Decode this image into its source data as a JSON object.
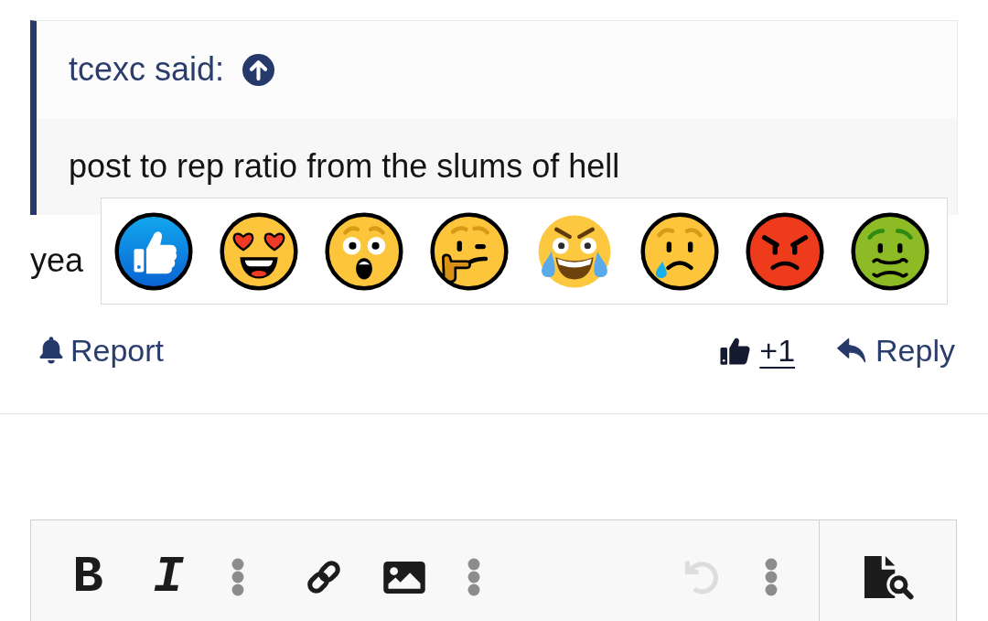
{
  "quote": {
    "author": "tcexc said:",
    "text": "post to rep ratio from the slums of hell"
  },
  "post": {
    "text": "yea"
  },
  "reaction_picker": {
    "reactions": [
      {
        "kind": "like"
      },
      {
        "kind": "love"
      },
      {
        "kind": "wow"
      },
      {
        "kind": "thinking"
      },
      {
        "kind": "haha"
      },
      {
        "kind": "sad"
      },
      {
        "kind": "angry"
      },
      {
        "kind": "sick"
      }
    ]
  },
  "actions": {
    "report": "Report",
    "reaction_count": "+1",
    "reply": "Reply"
  },
  "editor_toolbar": {
    "groups": [
      {
        "tools": [
          {
            "kind": "bold",
            "label": "B",
            "disabled": false
          },
          {
            "kind": "italic",
            "label": "I",
            "disabled": false
          },
          {
            "kind": "more",
            "disabled": false
          }
        ]
      },
      {
        "tools": [
          {
            "kind": "link",
            "disabled": false
          },
          {
            "kind": "image",
            "disabled": false
          },
          {
            "kind": "more",
            "disabled": false
          }
        ]
      },
      {
        "tools": [
          {
            "kind": "undo",
            "disabled": true
          },
          {
            "kind": "more",
            "disabled": false
          }
        ]
      }
    ],
    "side_tools": [
      {
        "kind": "preview",
        "disabled": false
      }
    ]
  }
}
